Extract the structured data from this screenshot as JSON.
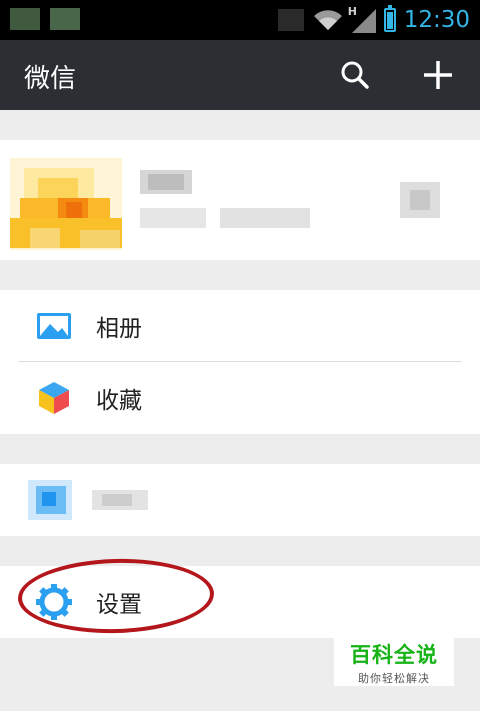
{
  "status_bar": {
    "time": "12:30",
    "network": "H",
    "battery_level": 0.85
  },
  "header": {
    "title": "微信",
    "search_icon": "search-icon",
    "add_icon": "plus-icon"
  },
  "menu": {
    "album_label": "相册",
    "favorites_label": "收藏",
    "settings_label": "设置"
  },
  "watermark": {
    "title": "百科全说",
    "subtitle": "助你轻松解决"
  },
  "colors": {
    "accent": "#33b5e5",
    "appbar": "#2b2f33",
    "highlight": "#b3161b",
    "watermark_green": "#16b316"
  }
}
